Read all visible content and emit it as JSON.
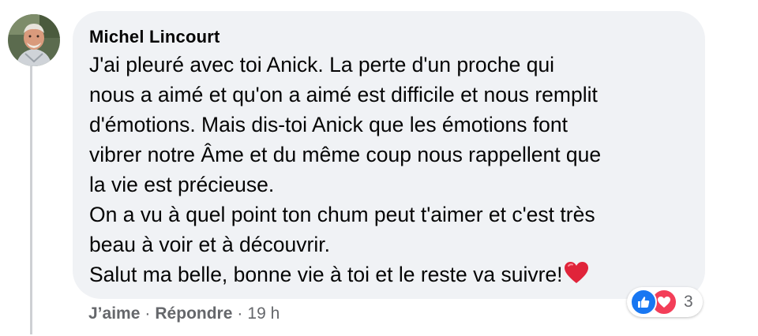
{
  "comment": {
    "author": "Michel Lincourt",
    "lines": [
      "J'ai pleuré avec toi Anick. La perte d'un proche qui",
      "nous a aimé et qu'on a aimé est difficile et nous remplit",
      "d'émotions. Mais dis-toi Anick que les émotions font",
      "vibrer notre Âme et du même coup nous rappellent que",
      "la vie est précieuse.",
      "On a vu à quel point ton chum peut t'aimer et c'est très",
      "beau à voir et à découvrir.",
      "Salut ma belle, bonne vie à toi et le reste va suivre!"
    ],
    "reactions": {
      "icons": [
        "like-icon",
        "love-icon"
      ],
      "count": "3"
    },
    "actions": {
      "like_label": "J’aime",
      "separator": "·",
      "reply_label": "Répondre",
      "timestamp": "19 h"
    }
  },
  "colors": {
    "bubble": "#f0f2f5",
    "text": "#050505",
    "secondary_text": "#65676b",
    "like": "#1877f2",
    "love": "#f33e58",
    "thread_line": "#ced0d4"
  }
}
